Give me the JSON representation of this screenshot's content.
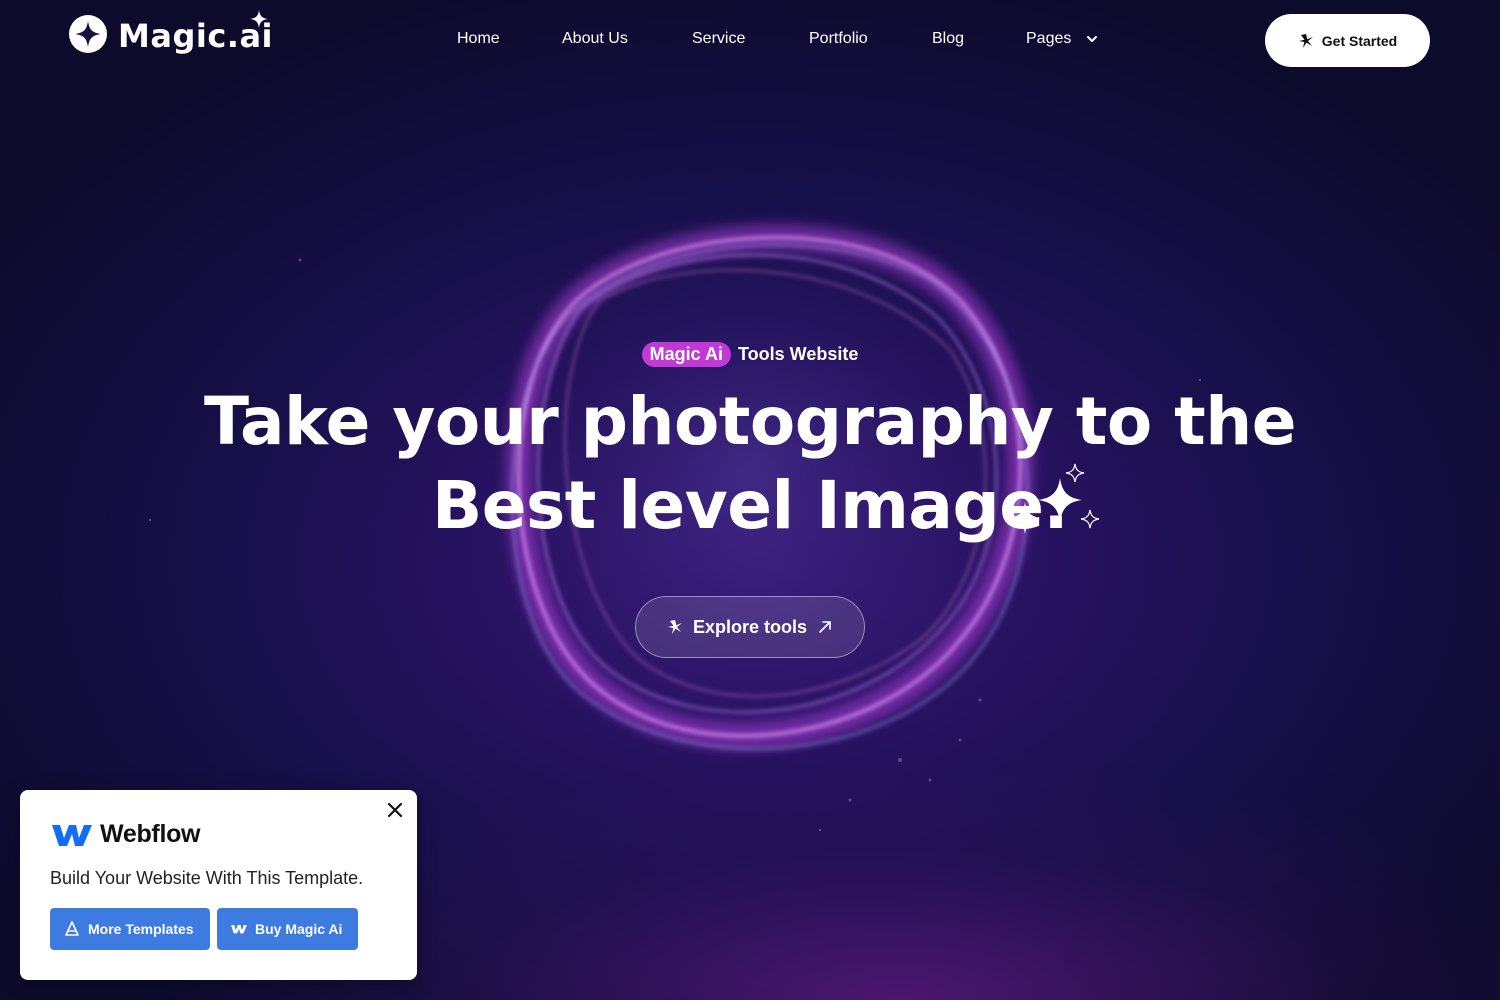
{
  "header": {
    "logo_text": "Magic.ai",
    "nav": [
      "Home",
      "About Us",
      "Service",
      "Portfolio",
      "Blog",
      "Pages"
    ],
    "cta_label": "Get Started"
  },
  "hero": {
    "badge": "Magic Ai",
    "eyebrow_rest": "Tools Website",
    "title_line1": "Take your photography to the",
    "title_line2": "Best level Image.",
    "cta_label": "Explore tools"
  },
  "promo_card": {
    "brand": "Webflow",
    "text": "Build Your Website With This Template.",
    "btn_more": "More Templates",
    "btn_buy": "Buy Magic Ai"
  },
  "colors": {
    "accent": "#c13ad8",
    "background": "#0f0b2a",
    "card_button": "#3d7be0"
  },
  "icons": [
    "logo-star-icon",
    "chevron-down-icon",
    "sparkle-icon",
    "arrow-up-right-icon",
    "close-icon",
    "webflow-logo-icon",
    "template-icon"
  ]
}
